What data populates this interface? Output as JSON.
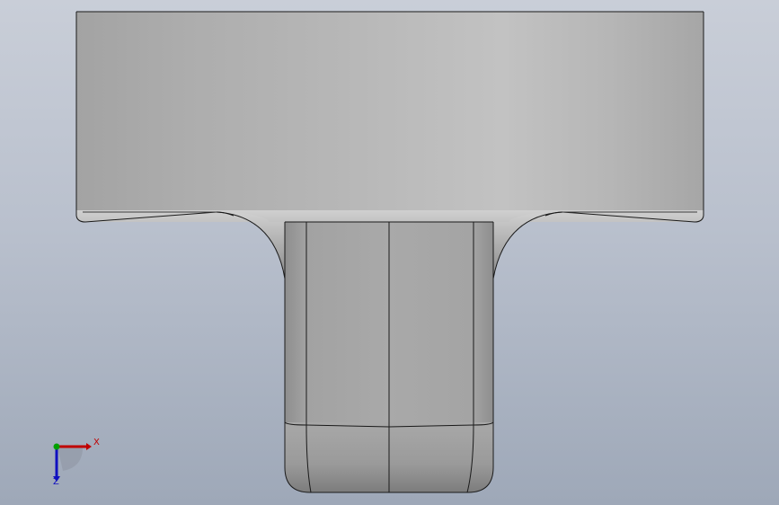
{
  "view": {
    "background_top": "#c9ced8",
    "background_bottom": "#9ea8b8"
  },
  "model": {
    "name": "t-shaped-part",
    "face_color": "#b8b8b8",
    "edge_color": "#1a1a1a"
  },
  "triad": {
    "x_label": "X",
    "z_label": "Z",
    "x_color": "#c00000",
    "y_color": "#00a000",
    "z_color": "#1010c0"
  }
}
